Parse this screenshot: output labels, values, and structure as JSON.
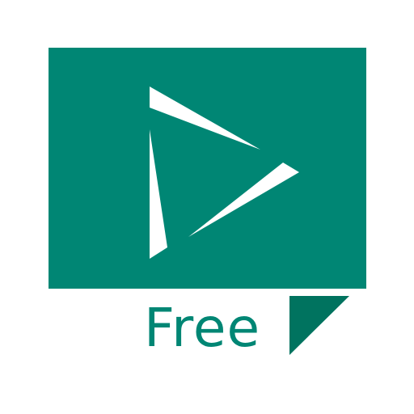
{
  "app": {
    "badge_label": "Free"
  },
  "icons": {
    "play": "play-icon",
    "fold": "page-corner-icon"
  },
  "colors": {
    "brand": "#008674",
    "brand_dark": "#00735f",
    "background": "#ffffff",
    "glyph": "#ffffff"
  }
}
